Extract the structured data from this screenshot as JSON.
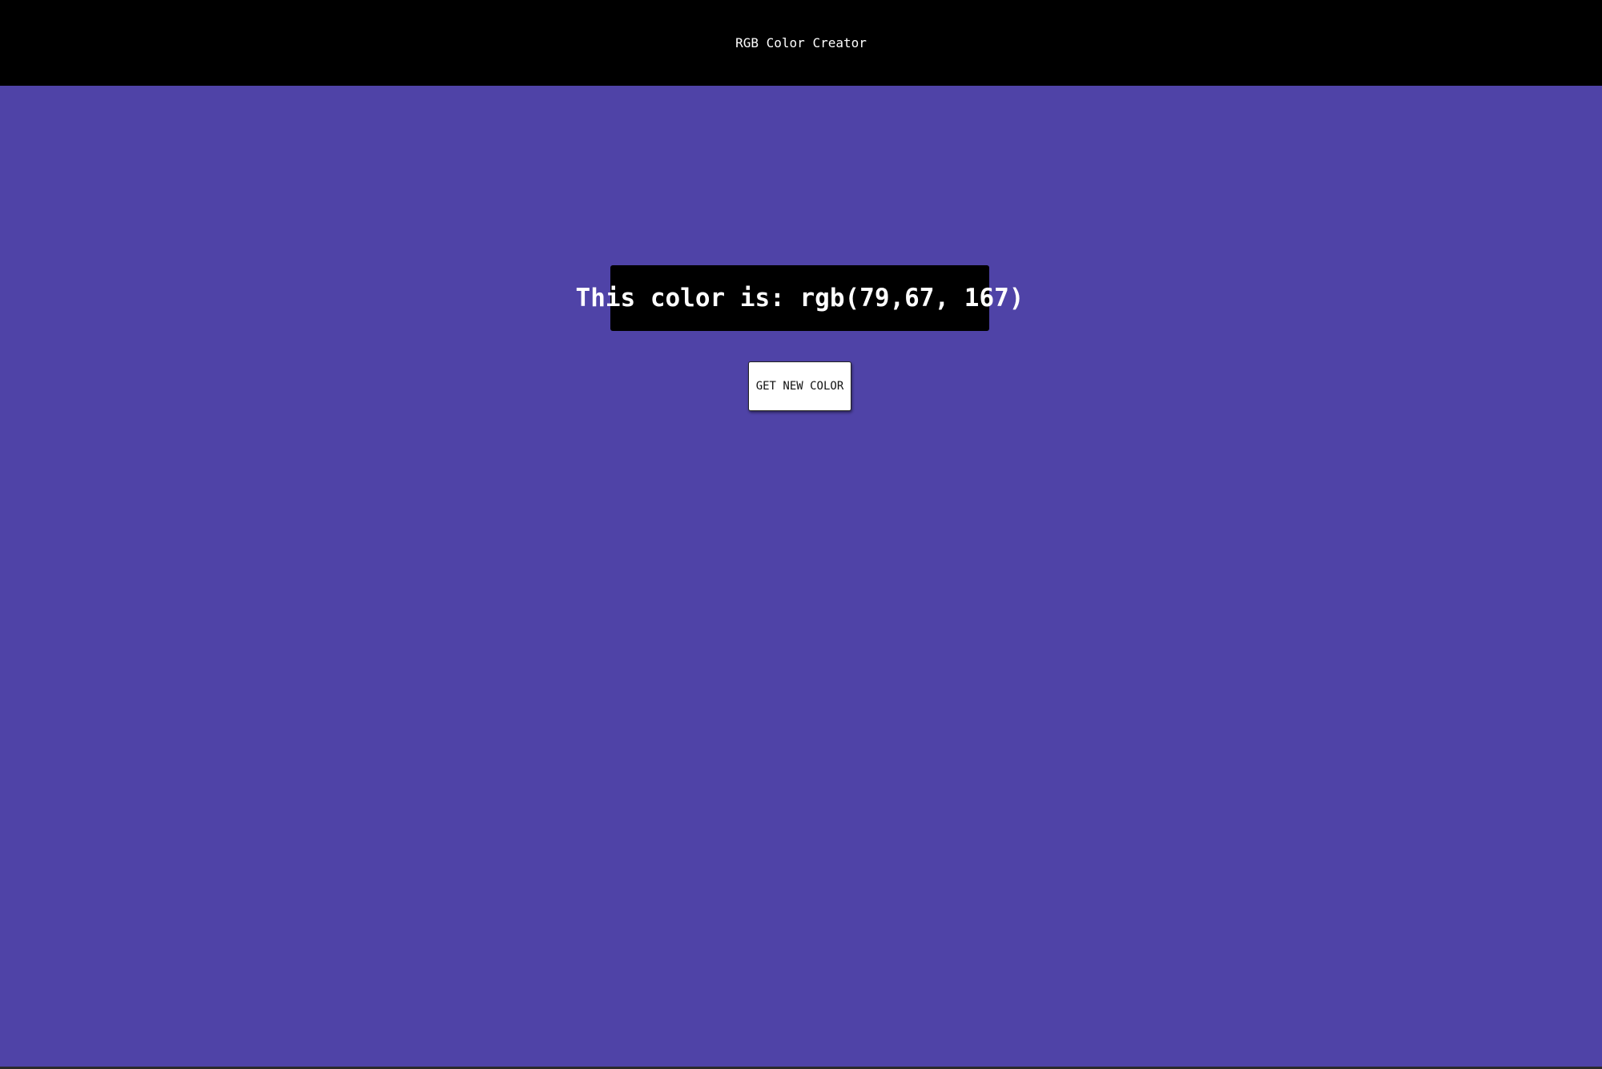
{
  "header": {
    "title": "RGB Color Creator"
  },
  "main": {
    "color_label_prefix": "This color is: ",
    "color_value": "rgb(79,67, 167)",
    "new_color_button_label": "GET NEW COLOR",
    "background_color": "#4f43a7"
  },
  "colors": {
    "topbar": "#000000",
    "label_background": "#000000",
    "button_background": "#ffffff"
  }
}
